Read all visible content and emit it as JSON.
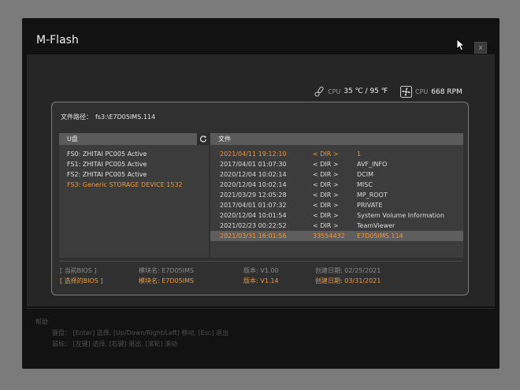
{
  "window": {
    "title": "M-Flash",
    "close_label": "x"
  },
  "status": {
    "temp_label": "CPU",
    "temp_value": "35 ℃ / 95 ℉",
    "fan_label": "CPU",
    "fan_value": "668 RPM"
  },
  "path": {
    "label": "文件路径：",
    "value": "fs3:\\E7D05IMS.114"
  },
  "left_column": {
    "header": "U盘",
    "drives": [
      {
        "label": "FS0: ZHITAI PC005 Active"
      },
      {
        "label": "FS1: ZHITAI PC005 Active"
      },
      {
        "label": "FS2: ZHITAI PC005 Active"
      },
      {
        "label": "FS3: Generic STORAGE DEVICE 1532"
      }
    ]
  },
  "right_column": {
    "header": "文件",
    "files": [
      {
        "date": "2021/04/11 19:12:10",
        "type": "< DIR >",
        "name": "1"
      },
      {
        "date": "2017/04/01 01:07:30",
        "type": "< DIR >",
        "name": "AVF_INFO"
      },
      {
        "date": "2020/12/04 10:02:14",
        "type": "< DIR >",
        "name": "DCIM"
      },
      {
        "date": "2020/12/04 10:02:14",
        "type": "< DIR >",
        "name": "MISC"
      },
      {
        "date": "2021/03/29 12:05:28",
        "type": "< DIR >",
        "name": "MP_ROOT"
      },
      {
        "date": "2017/04/01 01:07:32",
        "type": "< DIR >",
        "name": "PRIVATE"
      },
      {
        "date": "2020/12/04 10:01:54",
        "type": "< DIR >",
        "name": "System Volume Information"
      },
      {
        "date": "2021/02/23 00:22:52",
        "type": "< DIR >",
        "name": "TeamViewer"
      },
      {
        "date": "2021/03/31 16:01:56",
        "type": "33554432",
        "name": "E7D05IMS.114"
      }
    ]
  },
  "bios": {
    "current": {
      "label": "[     当前BIOS     ]",
      "model": "模块名: E7D05IMS",
      "version": "版本: V1.00",
      "date": "创建日期: 02/25/2021"
    },
    "selected": {
      "label": "[   选择的BIOS   ]",
      "model": "模块名: E7D05IMS",
      "version": "版本: V1.14",
      "date": "创建日期: 03/31/2021"
    }
  },
  "help": {
    "title": "帮助",
    "line1": "键盘：  [Enter] 选择,   [Up/Down/Right/Left] 移动,   [Esc] 退出",
    "line2": "鼠标：  [左键] 选择,   [右键] 退出,   [滚轮] 滚动"
  },
  "colors": {
    "accent": "#e79a44",
    "background": "#121212",
    "panel": "#303030"
  }
}
